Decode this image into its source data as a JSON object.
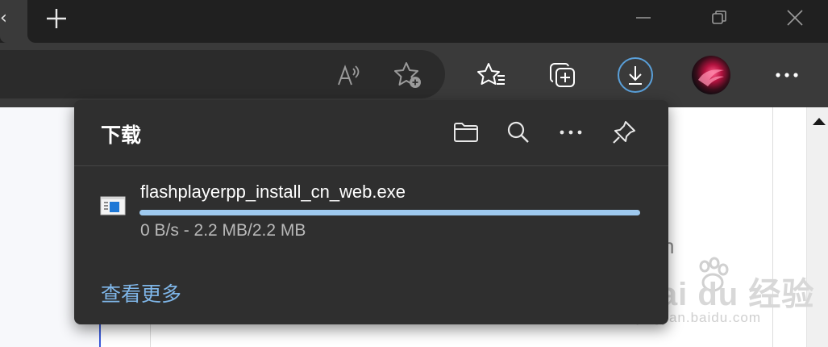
{
  "window": {
    "new_tab_icon": "plus-icon",
    "minimize_icon": "minimize-icon",
    "restore_icon": "restore-icon",
    "close_icon": "close-icon"
  },
  "toolbar": {
    "icons": [
      "read-aloud-icon",
      "add-favorite-icon",
      "favorites-icon",
      "collections-icon",
      "downloads-icon",
      "profile-avatar",
      "more-icon"
    ]
  },
  "downloads": {
    "title": "下载",
    "header_icons": [
      "folder-icon",
      "search-icon",
      "more-icon",
      "pin-icon"
    ],
    "items": [
      {
        "file_name": "flashplayerpp_install_cn_web.exe",
        "status": "0 B/s - 2.2 MB/2.2 MB",
        "progress": 1.0
      }
    ],
    "see_more": "查看更多"
  },
  "page": {
    "partial_text": "n",
    "watermark_main": "Bai du 经验",
    "watermark_sub": "jingyan.baidu.com"
  },
  "colors": {
    "accent": "#5aa0da",
    "progress": "#9ec9ee",
    "link": "#7fb6e8"
  }
}
